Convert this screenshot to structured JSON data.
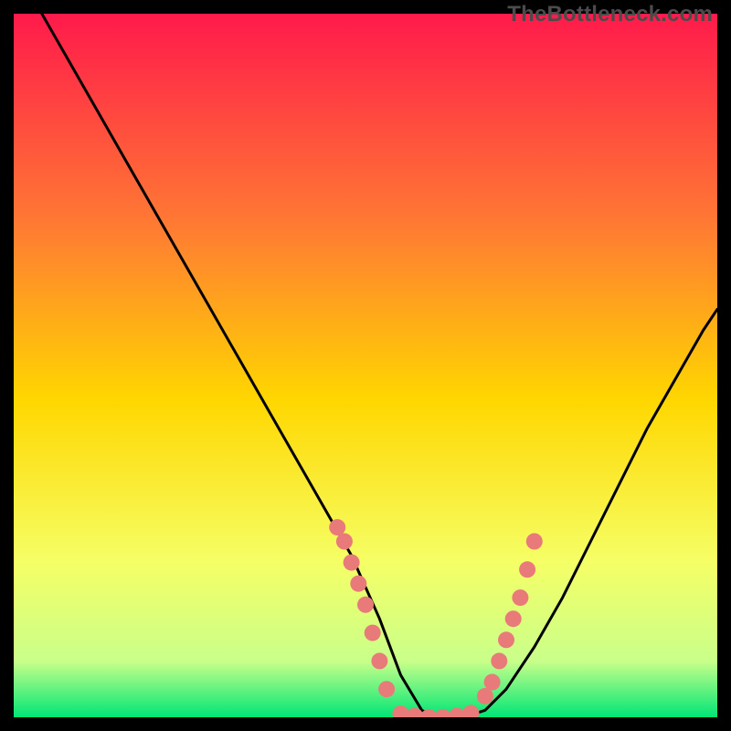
{
  "watermark": "TheBottleneck.com",
  "colors": {
    "background": "#000000",
    "curve": "#000000",
    "dots": "#e97a7a",
    "gradient_top": "#ff1a4b",
    "gradient_mid_upper": "#ff7a33",
    "gradient_mid": "#ffd700",
    "gradient_mid_lower": "#f5ff66",
    "gradient_lower": "#c9ff8a",
    "gradient_bottom": "#00e676"
  },
  "chart_data": {
    "type": "line",
    "title": "",
    "xlabel": "",
    "ylabel": "",
    "xlim": [
      0,
      100
    ],
    "ylim": [
      0,
      100
    ],
    "series": [
      {
        "name": "bottleneck-curve",
        "x": [
          4,
          8,
          12,
          16,
          20,
          24,
          28,
          32,
          36,
          40,
          44,
          48,
          52,
          55,
          58,
          60,
          62,
          64,
          67,
          70,
          74,
          78,
          82,
          86,
          90,
          94,
          98,
          100
        ],
        "values": [
          100,
          93,
          86,
          79,
          72,
          65,
          58,
          51,
          44,
          37,
          30,
          23,
          14,
          6,
          1,
          0,
          0,
          0,
          1,
          4,
          10,
          17,
          25,
          33,
          41,
          48,
          55,
          58
        ]
      }
    ],
    "dots_left": {
      "x": [
        46,
        47,
        48,
        49,
        50,
        51,
        52,
        53
      ],
      "y": [
        27,
        25,
        22,
        19,
        16,
        12,
        8,
        4
      ]
    },
    "dots_right": {
      "x": [
        67,
        68,
        69,
        70,
        71,
        72,
        73,
        74
      ],
      "y": [
        3,
        5,
        8,
        11,
        14,
        17,
        21,
        25
      ]
    },
    "dots_bottom": {
      "x": [
        55,
        57,
        59,
        61,
        63,
        65
      ],
      "y": [
        0.5,
        0.2,
        0,
        0,
        0.2,
        0.6
      ]
    }
  }
}
